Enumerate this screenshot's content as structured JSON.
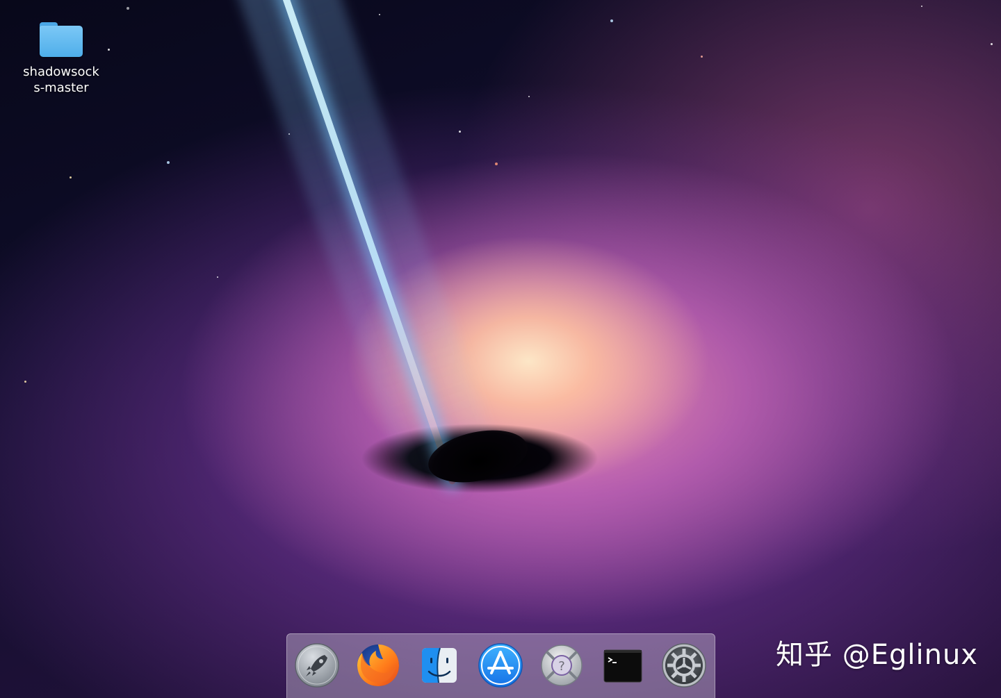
{
  "desktop": {
    "icons": [
      {
        "label": "shadowsocks-master",
        "icon": "folder-icon"
      }
    ]
  },
  "dock": {
    "items": [
      {
        "name": "launchpad",
        "icon": "rocket-icon"
      },
      {
        "name": "firefox",
        "icon": "firefox-icon"
      },
      {
        "name": "finder",
        "icon": "finder-icon"
      },
      {
        "name": "app-store",
        "icon": "app-store-icon"
      },
      {
        "name": "help",
        "icon": "lifebuoy-icon"
      },
      {
        "name": "terminal",
        "icon": "terminal-icon"
      },
      {
        "name": "system-settings",
        "icon": "gear-icon"
      }
    ]
  },
  "watermark": "知乎 @Eglinux",
  "colors": {
    "dock_bg": "#cdc3d7",
    "folder": "#5cb6ee",
    "appstore": "#1e8ff0"
  }
}
